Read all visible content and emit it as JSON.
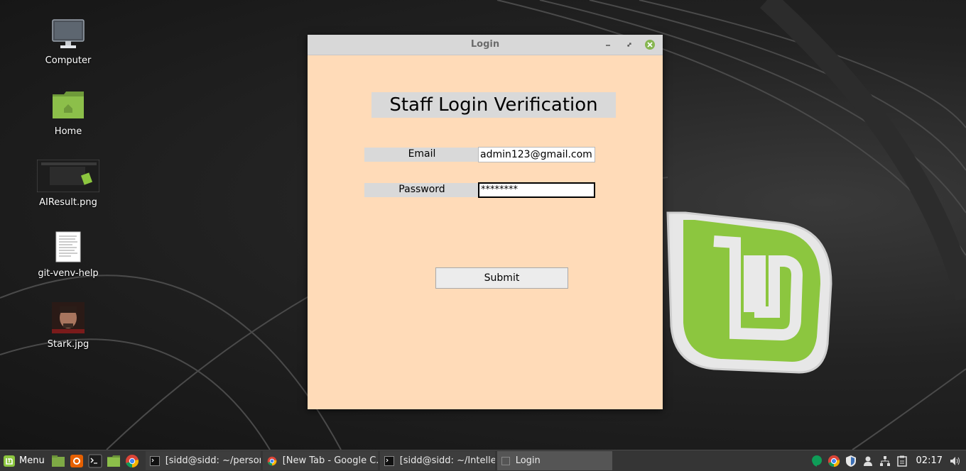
{
  "desktop": {
    "icons": [
      {
        "label": "Computer",
        "icon": "computer-icon"
      },
      {
        "label": "Home",
        "icon": "home-folder-icon"
      },
      {
        "label": "AIResult.png",
        "icon": "image-thumbnail-icon"
      },
      {
        "label": "git-venv-help",
        "icon": "text-file-icon"
      },
      {
        "label": "Stark.jpg",
        "icon": "photo-thumbnail-icon"
      }
    ]
  },
  "window": {
    "title": "Login",
    "heading": "Staff Login Verification",
    "email_label": "Email",
    "email_value": "admin123@gmail.com",
    "password_label": "Password",
    "password_value": "********",
    "submit_label": "Submit"
  },
  "taskbar": {
    "menu_label": "Menu",
    "quick_launch": [
      "show-desktop-icon",
      "firefox-icon",
      "terminal-icon",
      "files-icon",
      "chrome-icon"
    ],
    "tasks": [
      {
        "label": "[sidd@sidd: ~/person...",
        "icon": "terminal-icon",
        "active": false
      },
      {
        "label": "[New Tab - Google C...",
        "icon": "chrome-icon",
        "active": false
      },
      {
        "label": "[sidd@sidd: ~/Intellec...",
        "icon": "terminal-icon",
        "active": false
      },
      {
        "label": "Login",
        "icon": "window-icon",
        "active": true
      }
    ],
    "tray": [
      "hangouts-icon",
      "chrome-icon",
      "shield-icon",
      "user-icon",
      "network-icon",
      "clipboard-icon"
    ],
    "clock": "02:17"
  },
  "colors": {
    "window_bg": "#ffdbb8",
    "label_bg": "#d9d9d9",
    "mint_green": "#87c540"
  }
}
